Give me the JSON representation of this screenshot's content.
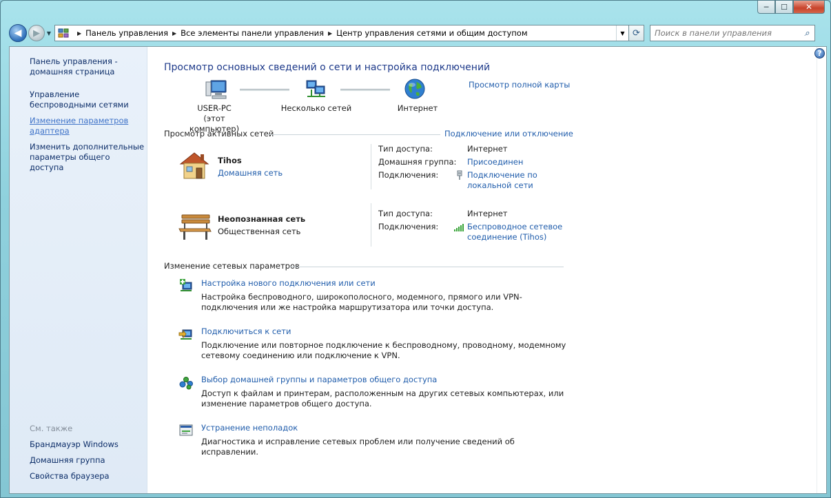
{
  "window": {
    "minimize": "─",
    "maximize": "☐",
    "close": "✕"
  },
  "address": {
    "crumbs": [
      "Панель управления",
      "Все элементы панели управления",
      "Центр управления сетями и общим доступом"
    ],
    "search_placeholder": "Поиск в панели управления"
  },
  "sidebar": {
    "links": [
      "Панель управления - домашняя страница",
      "Управление беспроводными сетями",
      "Изменение параметров адаптера",
      "Изменить дополнительные параметры общего доступа"
    ],
    "see_also_label": "См. также",
    "see_also": [
      "Брандмауэр Windows",
      "Домашняя группа",
      "Свойства браузера"
    ]
  },
  "main": {
    "title": "Просмотр основных сведений о сети и настройка подключений",
    "full_map_link": "Просмотр полной карты",
    "map": {
      "pc_name": "USER-PC",
      "pc_sub": "(этот компьютер)",
      "networks": "Несколько сетей",
      "internet": "Интернет"
    },
    "active_header": "Просмотр активных сетей",
    "connect_link": "Подключение или отключение",
    "networks": [
      {
        "name": "Tihos",
        "type": "Домашняя сеть",
        "access_label": "Тип доступа:",
        "access_value": "Интернет",
        "homegroup_label": "Домашняя группа:",
        "homegroup_value": "Присоединен",
        "conn_label": "Подключения:",
        "conn_value": "Подключение по локальной сети"
      },
      {
        "name": "Неопознанная сеть",
        "type": "Общественная сеть",
        "access_label": "Тип доступа:",
        "access_value": "Интернет",
        "conn_label": "Подключения:",
        "conn_value": "Беспроводное сетевое соединение (Tihos)"
      }
    ],
    "change_header": "Изменение сетевых параметров",
    "tasks": [
      {
        "title": "Настройка нового подключения или сети",
        "desc": "Настройка беспроводного, широкополосного, модемного, прямого или VPN-подключения или же настройка маршрутизатора или точки доступа."
      },
      {
        "title": "Подключиться к сети",
        "desc": "Подключение или повторное подключение к беспроводному, проводному, модемному сетевому соединению или подключение к VPN."
      },
      {
        "title": "Выбор домашней группы и параметров общего доступа",
        "desc": "Доступ к файлам и принтерам, расположенным на других сетевых компьютерах, или изменение параметров общего доступа."
      },
      {
        "title": "Устранение неполадок",
        "desc": "Диагностика и исправление сетевых проблем или получение сведений об исправлении."
      }
    ]
  },
  "colors": {
    "link": "#1f5cab",
    "title": "#1e3a8a",
    "sidebar_bg": "#e4eef8",
    "frame": "#8fd1dd"
  }
}
